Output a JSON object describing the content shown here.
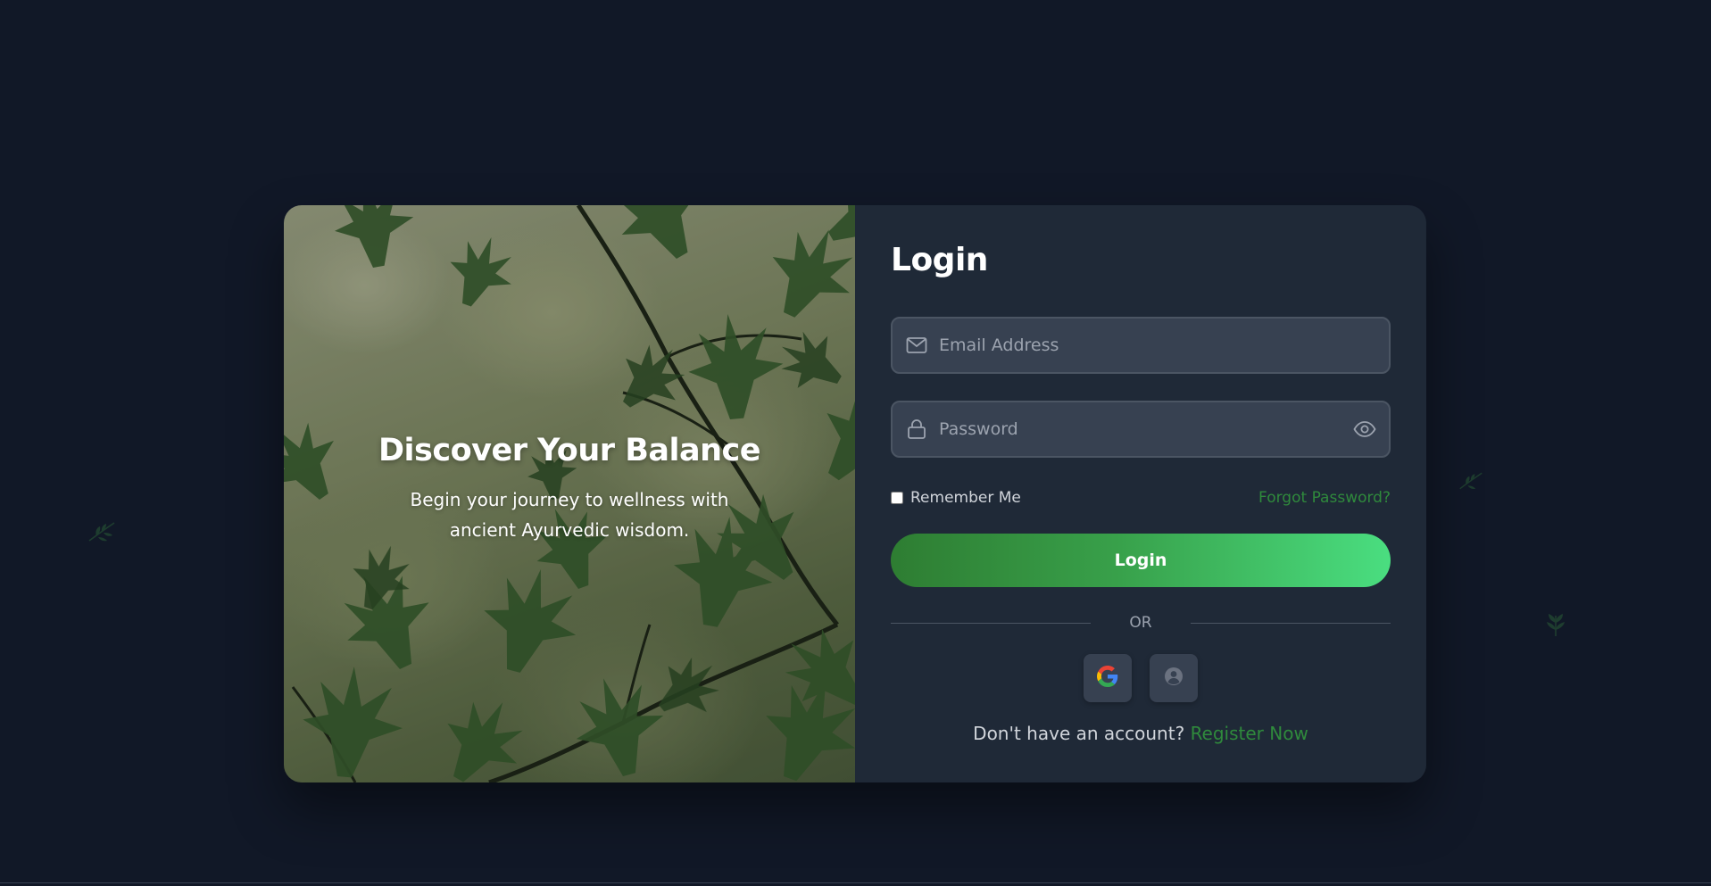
{
  "hero": {
    "title": "Discover Your Balance",
    "subtitle": "Begin your journey to wellness with ancient Ayurvedic wisdom."
  },
  "login": {
    "title": "Login",
    "email_placeholder": "Email Address",
    "password_placeholder": "Password",
    "remember_label": "Remember Me",
    "forgot_label": "Forgot Password?",
    "submit_label": "Login",
    "divider_label": "OR",
    "register_prompt": "Don't have an account?",
    "register_link": "Register Now"
  },
  "icons": {
    "email": "envelope-icon",
    "password": "lock-icon",
    "toggle": "eye-icon",
    "social_google": "google-icon",
    "social_guest": "user-circle-icon",
    "decor": "leaf-icon"
  },
  "colors": {
    "background": "#111827",
    "panel": "#1f2937",
    "field": "#374151",
    "accent": "#2f8a3c",
    "button_gradient_start": "#2e7d32",
    "button_gradient_end": "#4ade80"
  }
}
